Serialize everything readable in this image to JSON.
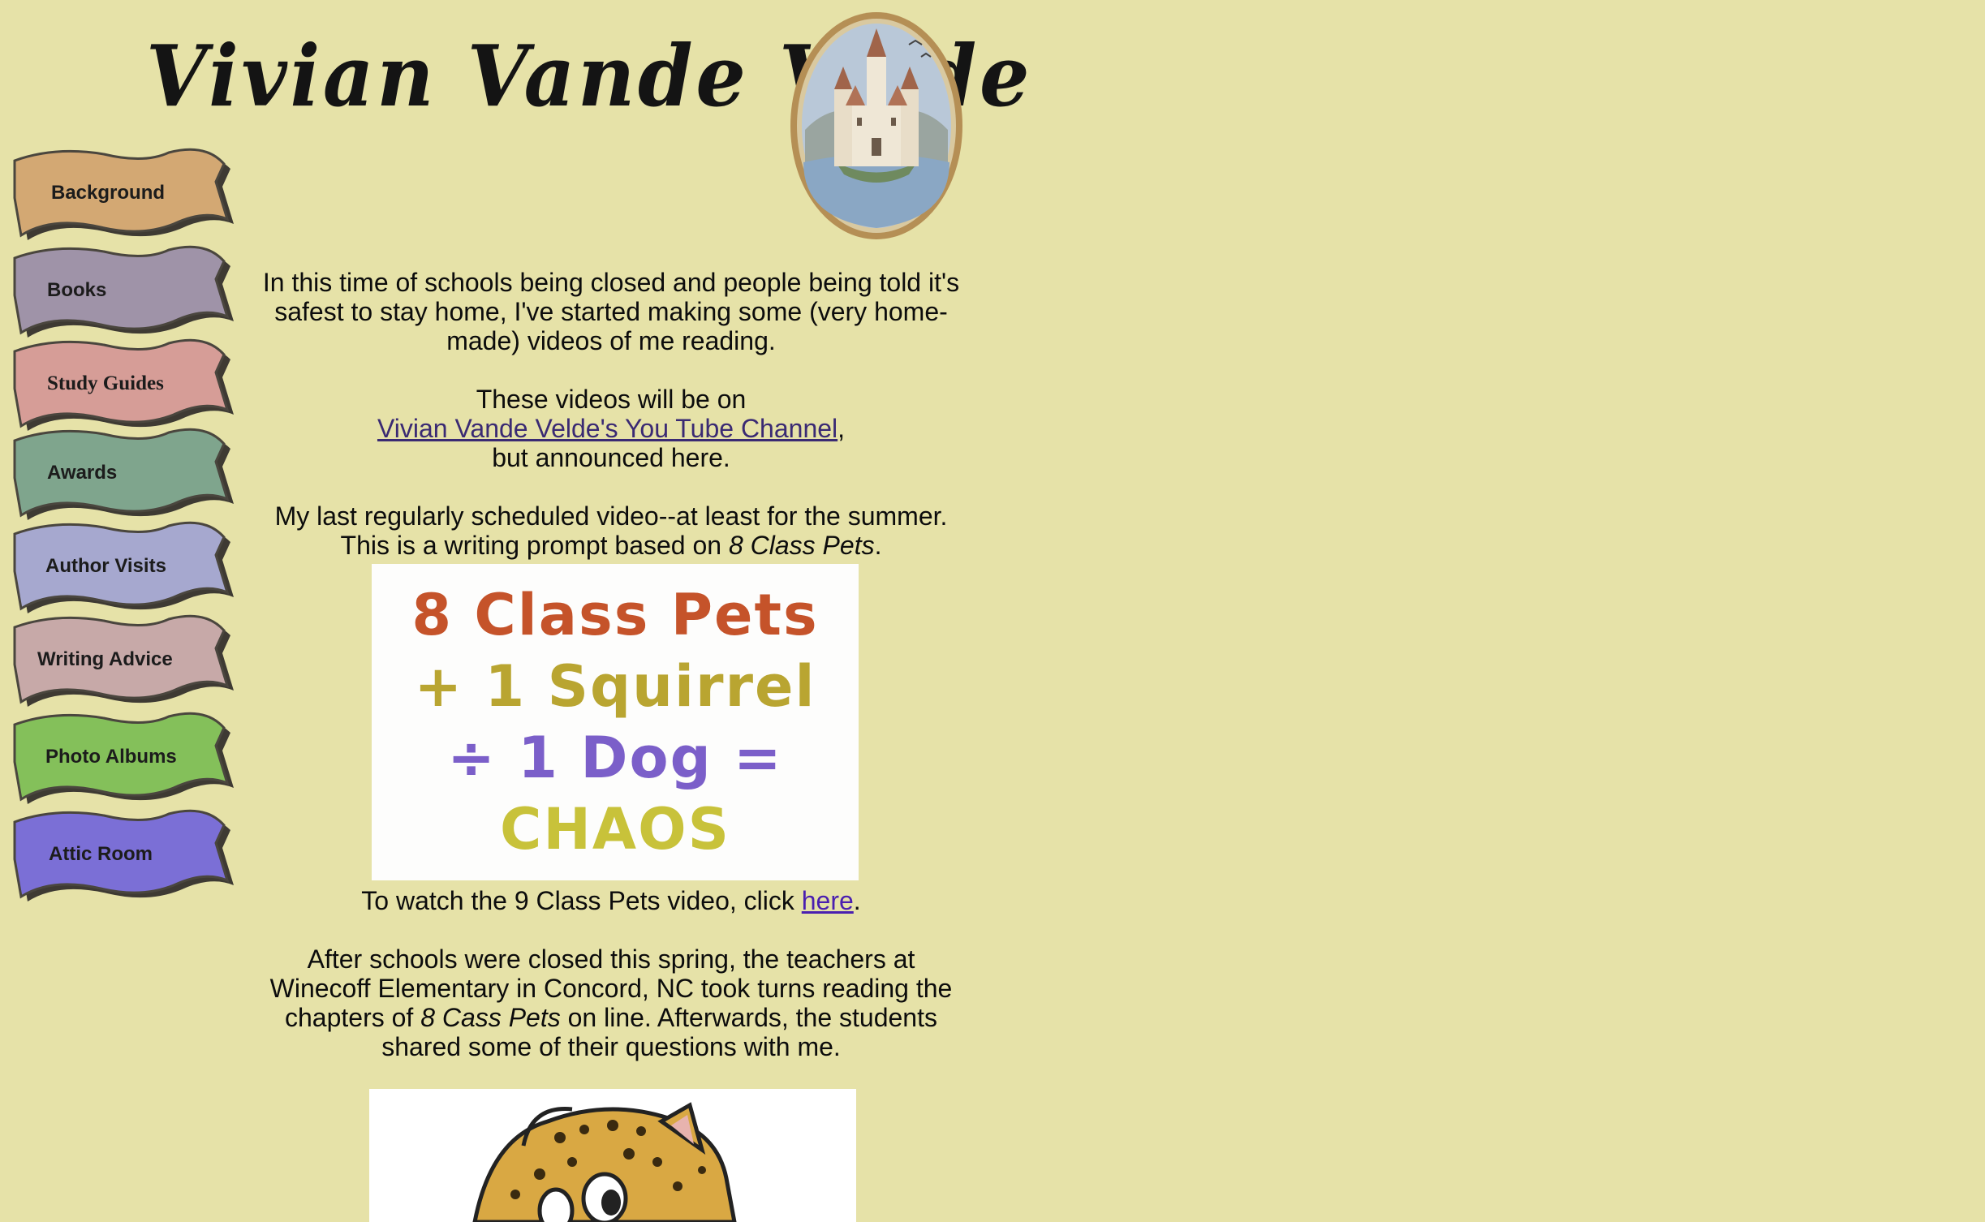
{
  "header": {
    "title": "Vivian Vande Velde",
    "castle_icon": "castle-medallion-icon"
  },
  "nav": {
    "items": [
      {
        "label": "Background",
        "color": "#d3a873"
      },
      {
        "label": "Books",
        "color": "#9f93a8"
      },
      {
        "label": "Study Guides",
        "color": "#d69d97"
      },
      {
        "label": "Awards",
        "color": "#7fa58d"
      },
      {
        "label": "Author Visits",
        "color": "#a6a8cf"
      },
      {
        "label": "Writing Advice",
        "color": "#c7a9a8"
      },
      {
        "label": "Photo Albums",
        "color": "#84c05a"
      },
      {
        "label": "Attic Room",
        "color": "#7b6fd6"
      }
    ]
  },
  "content": {
    "intro": "In this time of schools being closed and people being told it's safest to stay home, I've started making some (very home-made) videos of me reading.",
    "videos_line1": "These videos will be on",
    "youtube_link": "Vivian Vande Velde's You Tube Channel",
    "videos_line2": "but announced here.",
    "last_video_line1": "My last regularly scheduled video--at least for the summer.",
    "last_video_line2_prefix": "This is a writing prompt based on ",
    "last_video_book": "8 Class Pets",
    "pets_image": {
      "line1": "8 Class Pets",
      "line2": "+ 1 Squirrel",
      "line3": "÷ 1 Dog =",
      "line4": "CHAOS"
    },
    "watch_prefix": "To watch the 9 Class Pets video, click ",
    "watch_link": "here",
    "winecoff_part1": "After schools were closed this spring, the teachers at Winecoff Elementary in Concord, NC took turns reading the chapters of ",
    "winecoff_book": "8 Cass Pets",
    "winecoff_part2": " on line. Afterwards, the students shared some of their questions with me.",
    "cheetah_icon": "cheetah-illustration-icon"
  }
}
